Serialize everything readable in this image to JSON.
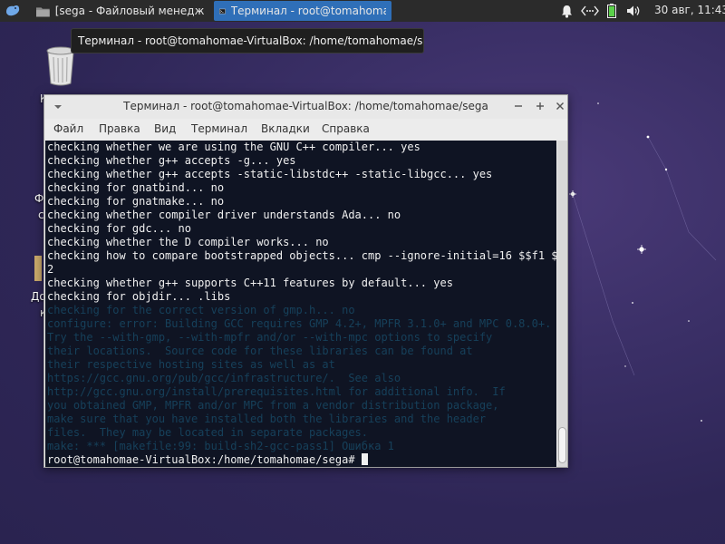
{
  "panel": {
    "tasks": [
      {
        "label": "[sega - Файловый менеджер",
        "icon": "folder-icon"
      },
      {
        "label": "Терминал - root@tomahomae-VirtualBox: /home/tomahomae/sega",
        "icon": "terminal-icon"
      }
    ],
    "clock": "30 авг, 11:43",
    "tray_icons": [
      "bell-icon",
      "network-icon",
      "battery-icon",
      "volume-icon"
    ]
  },
  "tooltip": {
    "text": "Терминал - root@tomahomae-VirtualBox: /home/tomahomae/sega"
  },
  "desktop": {
    "fragments": [
      "К",
      "Ф",
      "с",
      "Д",
      "До",
      "к"
    ]
  },
  "window": {
    "title": "Терминал - root@tomahomae-VirtualBox: /home/tomahomae/sega",
    "menu": [
      "Файл",
      "Правка",
      "Вид",
      "Терминал",
      "Вкладки",
      "Справка"
    ],
    "terminal_lines": [
      {
        "text": "checking whether we are using the GNU C++ compiler... yes",
        "dim": false
      },
      {
        "text": "checking whether g++ accepts -g... yes",
        "dim": false
      },
      {
        "text": "checking whether g++ accepts -static-libstdc++ -static-libgcc... yes",
        "dim": false
      },
      {
        "text": "checking for gnatbind... no",
        "dim": false
      },
      {
        "text": "checking for gnatmake... no",
        "dim": false
      },
      {
        "text": "checking whether compiler driver understands Ada... no",
        "dim": false
      },
      {
        "text": "checking for gdc... no",
        "dim": false
      },
      {
        "text": "checking whether the D compiler works... no",
        "dim": false
      },
      {
        "text": "checking how to compare bootstrapped objects... cmp --ignore-initial=16 $$f1 $$f",
        "dim": false
      },
      {
        "text": "2",
        "dim": false
      },
      {
        "text": "checking whether g++ supports C++11 features by default... yes",
        "dim": false
      },
      {
        "text": "checking for objdir... .libs",
        "dim": false
      },
      {
        "text": "checking for the correct version of gmp.h... no",
        "dim": true
      },
      {
        "text": "configure: error: Building GCC requires GMP 4.2+, MPFR 3.1.0+ and MPC 0.8.0+.",
        "dim": true
      },
      {
        "text": "Try the --with-gmp, --with-mpfr and/or --with-mpc options to specify",
        "dim": true
      },
      {
        "text": "their locations.  Source code for these libraries can be found at",
        "dim": true
      },
      {
        "text": "their respective hosting sites as well as at",
        "dim": true
      },
      {
        "text": "https://gcc.gnu.org/pub/gcc/infrastructure/.  See also",
        "dim": true
      },
      {
        "text": "http://gcc.gnu.org/install/prerequisites.html for additional info.  If",
        "dim": true
      },
      {
        "text": "you obtained GMP, MPFR and/or MPC from a vendor distribution package,",
        "dim": true
      },
      {
        "text": "make sure that you have installed both the libraries and the header",
        "dim": true
      },
      {
        "text": "files.  They may be located in separate packages.",
        "dim": true
      },
      {
        "text": "make: *** [makefile:99: build-sh2-gcc-pass1] Ошибка 1",
        "dim": true
      }
    ],
    "prompt": "root@tomahomae-VirtualBox:/home/tomahomae/sega# "
  },
  "colors": {
    "terminal_bg": "#0f1423",
    "terminal_fg": "#f0f0f0",
    "dim_text": "#16405a",
    "active_task": "#2f6fb8",
    "panel_bg": "#2b2b2b"
  }
}
